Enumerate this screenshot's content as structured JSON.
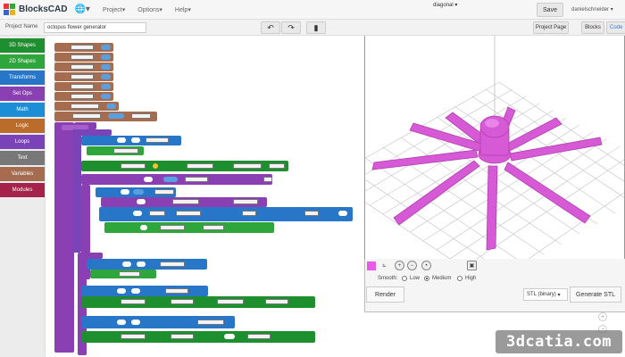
{
  "app": {
    "logo_text": "BlocksCAD",
    "nav": [
      "Project",
      "Options",
      "Help"
    ],
    "save_label": "Save",
    "user": "danielschneider"
  },
  "toolbar": {
    "project_name_label": "Project Name",
    "project_name_value": "octopus flower generator",
    "undo_icon": "undo-arrow-icon",
    "redo_icon": "redo-arrow-icon",
    "delete_icon": "trash-icon",
    "project_page_label": "Project Page",
    "blocks_tab_label": "Blocks",
    "code_tab_label": "Code"
  },
  "categories": [
    {
      "label": "3D Shapes",
      "color": "#1e8f2e"
    },
    {
      "label": "2D Shapes",
      "color": "#2ea63c"
    },
    {
      "label": "Transforms",
      "color": "#2776c8"
    },
    {
      "label": "Set Ops",
      "color": "#8a3fb2"
    },
    {
      "label": "Math",
      "color": "#1c8ed6"
    },
    {
      "label": "Logic",
      "color": "#bb6b2a"
    },
    {
      "label": "Loops",
      "color": "#7a44b8"
    },
    {
      "label": "Text",
      "color": "#787878"
    },
    {
      "label": "Variables",
      "color": "#a56c4f"
    },
    {
      "label": "Modules",
      "color": "#a5234a"
    }
  ],
  "viewer": {
    "colors": {
      "model": "#d65ad6",
      "model_light": "#ee8cee",
      "grid": "#c9c9c9"
    },
    "view_select": "diagonal",
    "smooth_label": "Smooth:",
    "smooth_options": [
      {
        "label": "Low",
        "selected": false
      },
      {
        "label": "Medium",
        "selected": true
      },
      {
        "label": "High",
        "selected": false
      }
    ],
    "render_label": "Render",
    "stl_select": "STL (binary)",
    "generate_label": "Generate STL"
  },
  "watermark": "3dcatia.com"
}
